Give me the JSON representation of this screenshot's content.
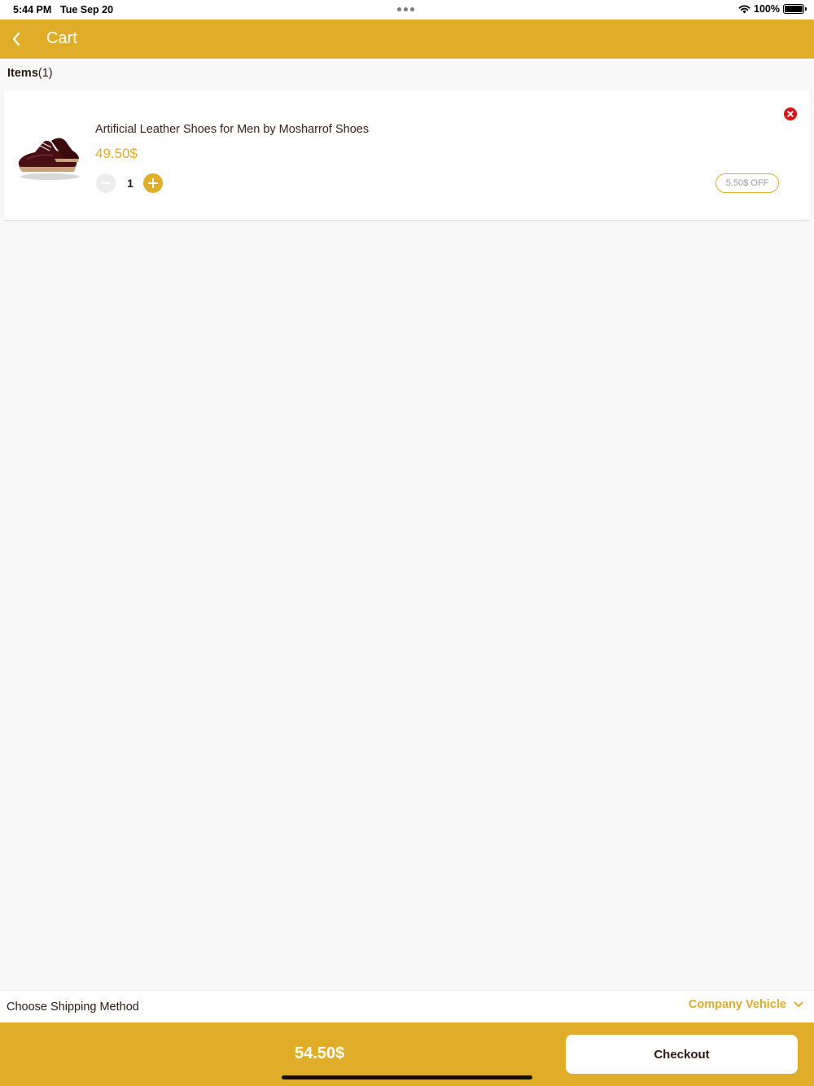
{
  "status_bar": {
    "time": "5:44 PM",
    "date": "Tue Sep 20",
    "battery": "100%",
    "icons": [
      "wifi-icon",
      "battery-icon"
    ]
  },
  "nav": {
    "back_icon": "chevron-left-icon",
    "title": "Cart"
  },
  "items_header": {
    "label": "Items",
    "count": "(1)"
  },
  "cart": {
    "items": [
      {
        "image_icon": "shoe-image",
        "name": "Artificial Leather Shoes for Men by Mosharrof Shoes",
        "price": "49.50$",
        "quantity": "1",
        "discount": "5.50$ OFF",
        "remove_icon": "close-icon"
      }
    ]
  },
  "shipping": {
    "label": "Choose Shipping Method",
    "selected": "Company Vehicle",
    "icon": "chevron-down-icon"
  },
  "checkout": {
    "total": "54.50$",
    "button_label": "Checkout"
  },
  "colors": {
    "accent": "#e0ad28",
    "remove": "#dc1212",
    "text": "#2b1a14",
    "background": "#f8f8f8"
  }
}
